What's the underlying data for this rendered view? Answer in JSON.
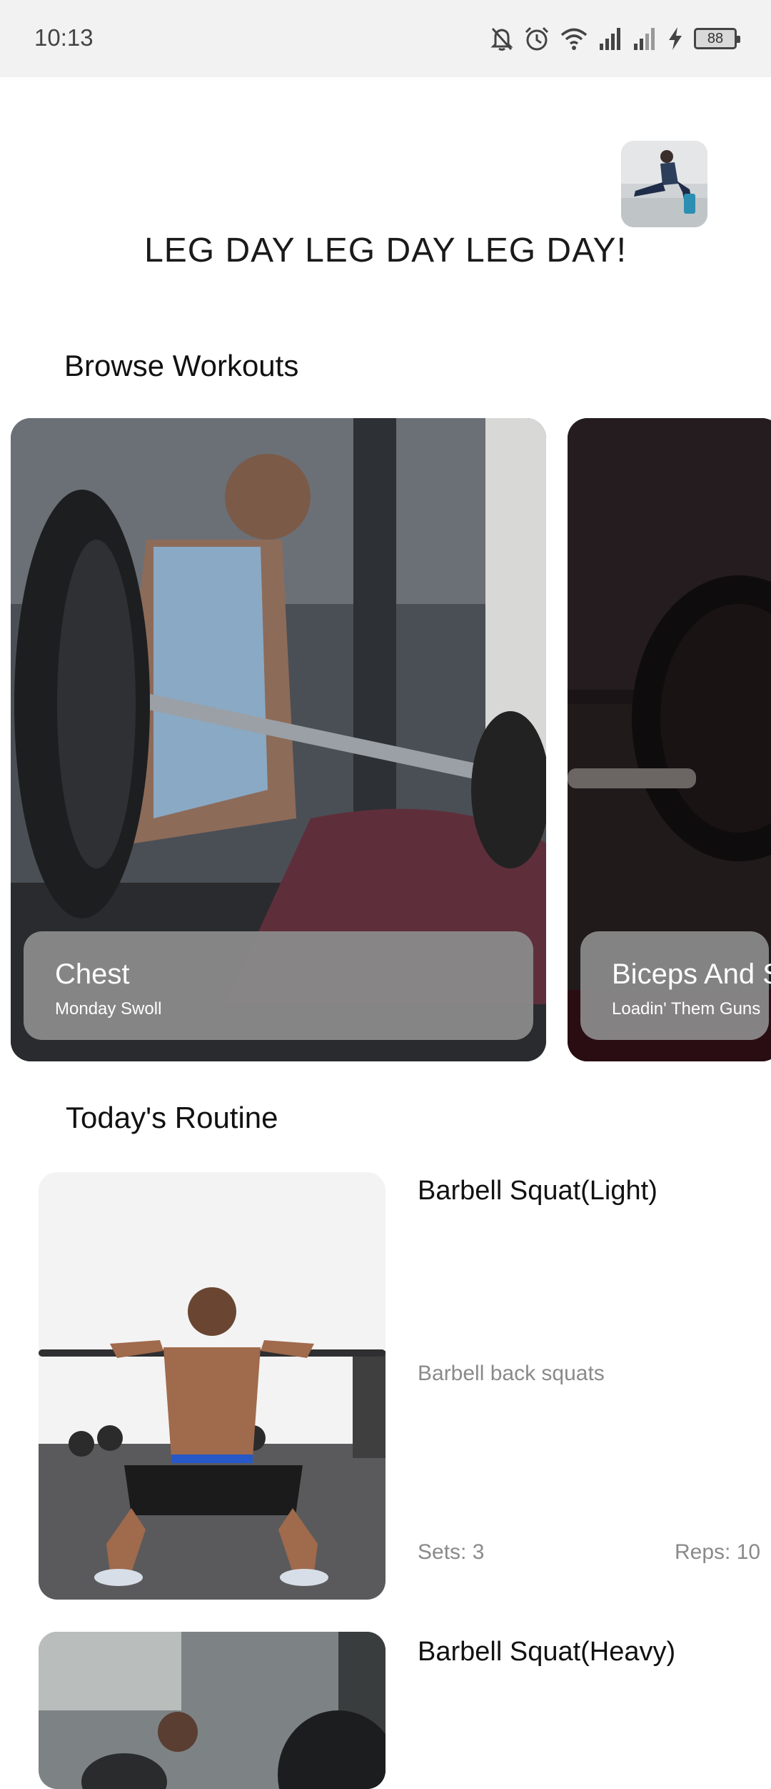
{
  "status_bar": {
    "time": "10:13",
    "battery": "88",
    "icons": [
      "bell-off-icon",
      "alarm-icon",
      "wifi-icon",
      "signal-icon",
      "signal-icon",
      "charging-icon",
      "battery-icon"
    ]
  },
  "header": {
    "avatar_icon": "profile-photo",
    "headline": "LEG DAY LEG DAY LEG DAY!"
  },
  "browse": {
    "title": "Browse Workouts",
    "cards": [
      {
        "title": "Chest",
        "subtitle": "Monday Swoll"
      },
      {
        "title": "Biceps And S",
        "subtitle": "Loadin' Them Guns"
      }
    ]
  },
  "routine": {
    "title": "Today's Routine",
    "items": [
      {
        "name": "Barbell Squat(Light)",
        "description": "Barbell back squats",
        "sets": "Sets: 3",
        "reps": "Reps: 10"
      },
      {
        "name": "Barbell Squat(Heavy)"
      }
    ]
  }
}
